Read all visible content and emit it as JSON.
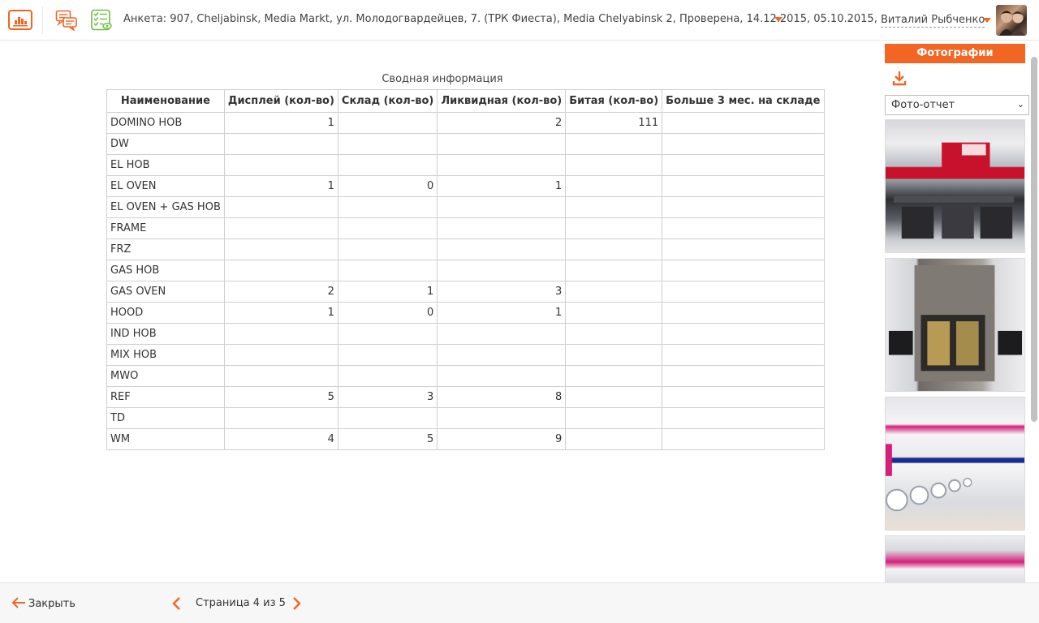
{
  "header": {
    "survey_title": "Анкета: 907, Cheljabinsk, Media Markt, ул. Молодогвардейцев, 7. (ТРК Фиеста), Media Chelyabinsk 2, Проверена, 14.12.2015, 05.10.2015,",
    "user_name": "Виталий Рыбченко",
    "accent_color": "#f26522",
    "icons": [
      "bar-chart-icon",
      "chat-icon",
      "checklist-icon",
      "chevron-down-icon",
      "avatar"
    ]
  },
  "main": {
    "caption": "Сводная информация",
    "columns": [
      "Наименование",
      "Дисплей (кол-во)",
      "Склад (кол-во)",
      "Ликвидная (кол-во)",
      "Битая (кол-во)",
      "Больше 3 мес. на складе"
    ],
    "rows": [
      [
        "DOMINO HOB",
        "1",
        "",
        "2",
        "111",
        ""
      ],
      [
        "DW",
        "",
        "",
        "",
        "",
        ""
      ],
      [
        "EL HOB",
        "",
        "",
        "",
        "",
        ""
      ],
      [
        "EL OVEN",
        "1",
        "0",
        "1",
        "",
        ""
      ],
      [
        "EL OVEN + GAS HOB",
        "",
        "",
        "",
        "",
        ""
      ],
      [
        "FRAME",
        "",
        "",
        "",
        "",
        ""
      ],
      [
        "FRZ",
        "",
        "",
        "",
        "",
        ""
      ],
      [
        "GAS HOB",
        "",
        "",
        "",
        "",
        ""
      ],
      [
        "GAS OVEN",
        "2",
        "1",
        "3",
        "",
        ""
      ],
      [
        "HOOD",
        "1",
        "0",
        "1",
        "",
        ""
      ],
      [
        "IND HOB",
        "",
        "",
        "",
        "",
        ""
      ],
      [
        "MIX HOB",
        "",
        "",
        "",
        "",
        ""
      ],
      [
        "MWO",
        "",
        "",
        "",
        "",
        ""
      ],
      [
        "REF",
        "5",
        "3",
        "8",
        "",
        ""
      ],
      [
        "TD",
        "",
        "",
        "",
        "",
        ""
      ],
      [
        "WM",
        "4",
        "5",
        "9",
        "",
        ""
      ]
    ]
  },
  "side_panel": {
    "tab_label": "Фотографии",
    "select_value": "Фото-отчет",
    "photos": [
      "store-photo-1",
      "store-photo-2",
      "store-photo-3",
      "store-photo-4"
    ]
  },
  "footer": {
    "close_label": "Закрыть",
    "page_label": "Страница 4 из 5"
  }
}
